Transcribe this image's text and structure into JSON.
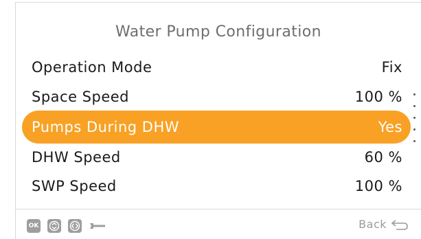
{
  "screen": {
    "title": "Water Pump Configuration"
  },
  "menu": {
    "items": [
      {
        "label": "Operation Mode",
        "value": "Fix",
        "selected": false
      },
      {
        "label": "Space Speed",
        "value": "100 %",
        "selected": false
      },
      {
        "label": "Pumps During DHW",
        "value": "Yes",
        "selected": true
      },
      {
        "label": "DHW Speed",
        "value": "60 %",
        "selected": false
      },
      {
        "label": "SWP Speed",
        "value": "100 %",
        "selected": false
      }
    ]
  },
  "footer": {
    "ok_key_label": "OK",
    "back_label": "Back",
    "icons": [
      "ok-key-icon",
      "up-down-key-icon",
      "left-right-key-icon",
      "wrench-icon",
      "back-arrow-icon"
    ]
  },
  "colors": {
    "highlight": "#f8a124",
    "text": "#1a1a1a",
    "title": "#6e6e6e",
    "footer": "#9a9a9a"
  }
}
